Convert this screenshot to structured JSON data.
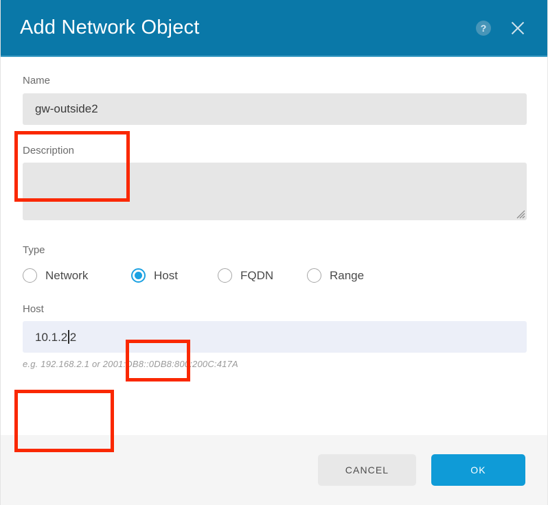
{
  "dialog": {
    "title": "Add Network Object",
    "help_icon": "help-circle-icon",
    "close_icon": "close-icon",
    "accent_color": "#0a78a8",
    "primary_button_color": "#0f9bd7",
    "annotation_color": "#fa2800"
  },
  "form": {
    "name": {
      "label": "Name",
      "value": "gw-outside2",
      "placeholder": ""
    },
    "description": {
      "label": "Description",
      "value": "",
      "placeholder": ""
    },
    "type": {
      "label": "Type",
      "selected": "Host",
      "options": [
        {
          "label": "Network",
          "selected": false
        },
        {
          "label": "Host",
          "selected": true
        },
        {
          "label": "FQDN",
          "selected": false
        },
        {
          "label": "Range",
          "selected": false
        }
      ]
    },
    "host": {
      "label": "Host",
      "value_before_caret": "10.1.2",
      "value_after_caret": "2",
      "value": "10.1.22",
      "placeholder": "",
      "hint": "e.g. 192.168.2.1 or 2001:DB8::0DB8:800:200C:417A"
    }
  },
  "footer": {
    "cancel_label": "CANCEL",
    "ok_label": "OK"
  }
}
